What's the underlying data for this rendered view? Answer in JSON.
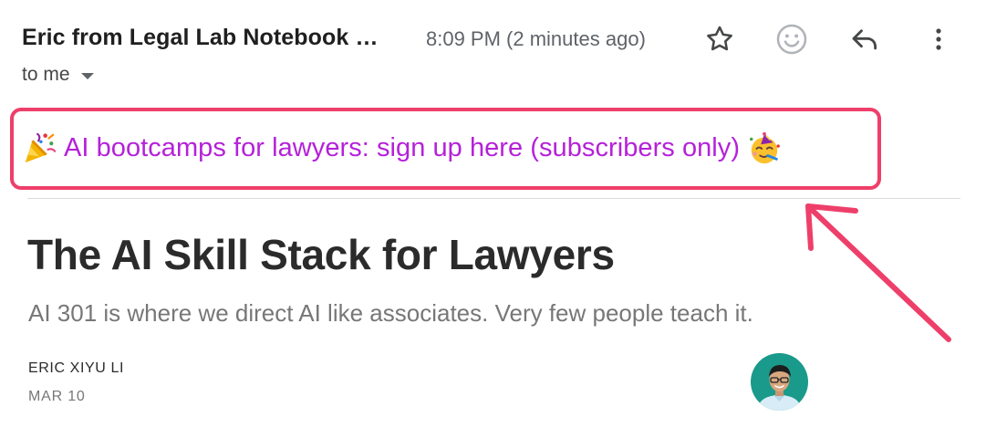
{
  "email_header": {
    "sender": "Eric from Legal Lab Notebook …",
    "time": "8:09 PM (2 minutes ago)",
    "recipient": "to me",
    "actions": [
      {
        "name": "star",
        "icon": "star-icon"
      },
      {
        "name": "react",
        "icon": "emoji-smile-icon"
      },
      {
        "name": "reply",
        "icon": "reply-icon"
      },
      {
        "name": "more",
        "icon": "more-vert-icon"
      }
    ]
  },
  "banner": {
    "text": "AI bootcamps for lawyers: sign up here (subscribers only)",
    "leading_emoji": "party-popper-icon",
    "trailing_emoji": "partying-face-icon",
    "text_color": "#b521d9",
    "highlight_color": "#ee3f6a"
  },
  "article": {
    "title": "The AI Skill Stack for Lawyers",
    "subtitle": "AI 301 is where we direct AI like associates. Very few people teach it.",
    "author": "ERIC XIYU LI",
    "date": "MAR 10"
  },
  "annotation": {
    "arrow_color": "#ee3f6a"
  }
}
